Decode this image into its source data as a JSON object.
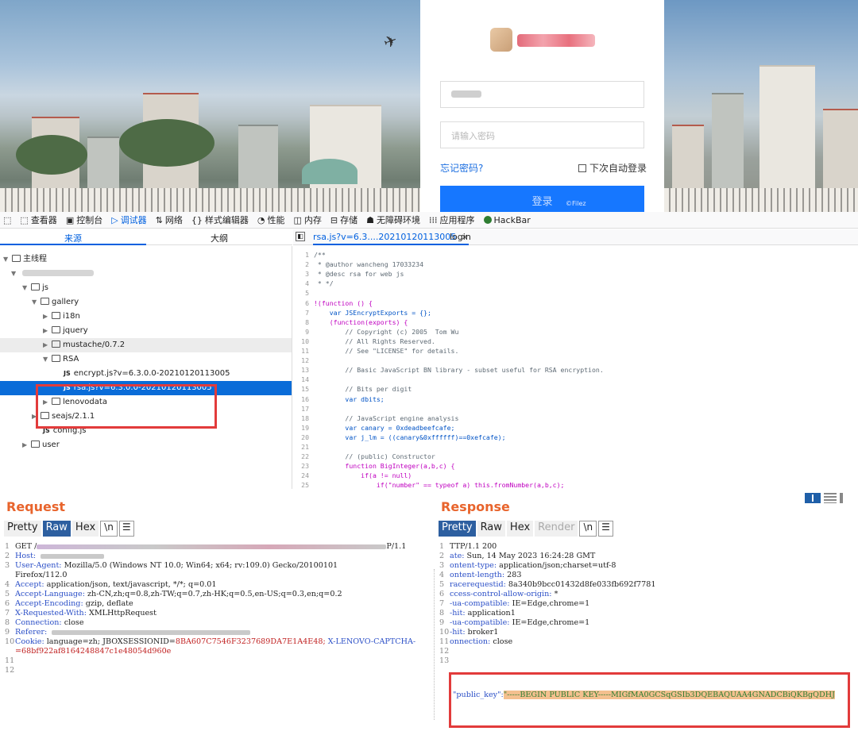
{
  "login": {
    "password_placeholder": "请输入密码",
    "forgot_password": "忘记密码?",
    "auto_login": "下次自动登录",
    "login_button": "登录",
    "watermark": "©Filez"
  },
  "devtools": {
    "toolbar": [
      {
        "icon": "⬚",
        "label": "查看器"
      },
      {
        "icon": "▣",
        "label": "控制台"
      },
      {
        "icon": "▷",
        "label": "调试器",
        "active": true
      },
      {
        "icon": "⇅",
        "label": "网络"
      },
      {
        "icon": "{}",
        "label": "样式编辑器"
      },
      {
        "icon": "◔",
        "label": "性能"
      },
      {
        "icon": "◫",
        "label": "内存"
      },
      {
        "icon": "⊟",
        "label": "存储"
      },
      {
        "icon": "☗",
        "label": "无障碍环境"
      },
      {
        "icon": "⁞⁞⁞",
        "label": "应用程序"
      },
      {
        "icon": "●",
        "label": "HackBar"
      }
    ],
    "tabs": {
      "sources": "来源",
      "outline": "大纲"
    },
    "tree": {
      "main_thread": "主线程",
      "js": "js",
      "gallery": "gallery",
      "i18n": "i18n",
      "jquery": "jquery",
      "mustache": "mustache/0.7.2",
      "rsa": "RSA",
      "encrypt_file": "encrypt.js?v=6.3.0.0-20210120113005",
      "rsa_file": "rsa.js?v=6.3.0.0-20210120113005",
      "lenovodata": "lenovodata",
      "seajs": "seajs/2.1.1",
      "config": "config.js",
      "user": "user",
      "js_badge": "JS"
    },
    "code_tabs": {
      "rsa": "rsa.js?v=6.3....20210120113005",
      "close": "×",
      "login": "login"
    },
    "code_lines": [
      {
        "n": "1",
        "t": "/**",
        "c": "c-cm"
      },
      {
        "n": "2",
        "t": " * @author wancheng 17033234",
        "c": "c-cm"
      },
      {
        "n": "3",
        "t": " * @desc rsa for web js",
        "c": "c-cm"
      },
      {
        "n": "4",
        "t": " * */",
        "c": "c-cm"
      },
      {
        "n": "5",
        "t": "",
        "c": "c-def"
      },
      {
        "n": "6",
        "t": "!(function () {",
        "c": "c-kw"
      },
      {
        "n": "7",
        "t": "    var JSEncryptExports = {};",
        "c": "c-fn"
      },
      {
        "n": "8",
        "t": "    (function(exports) {",
        "c": "c-kw"
      },
      {
        "n": "9",
        "t": "        // Copyright (c) 2005  Tom Wu",
        "c": "c-cm"
      },
      {
        "n": "10",
        "t": "        // All Rights Reserved.",
        "c": "c-cm"
      },
      {
        "n": "11",
        "t": "        // See \"LICENSE\" for details.",
        "c": "c-cm"
      },
      {
        "n": "12",
        "t": "",
        "c": "c-def"
      },
      {
        "n": "13",
        "t": "        // Basic JavaScript BN library - subset useful for RSA encryption.",
        "c": "c-cm"
      },
      {
        "n": "14",
        "t": "",
        "c": "c-def"
      },
      {
        "n": "15",
        "t": "        // Bits per digit",
        "c": "c-cm"
      },
      {
        "n": "16",
        "t": "        var dbits;",
        "c": "c-fn"
      },
      {
        "n": "17",
        "t": "",
        "c": "c-def"
      },
      {
        "n": "18",
        "t": "        // JavaScript engine analysis",
        "c": "c-cm"
      },
      {
        "n": "19",
        "t": "        var canary = 0xdeadbeefcafe;",
        "c": "c-fn"
      },
      {
        "n": "20",
        "t": "        var j_lm = ((canary&0xffffff)==0xefcafe);",
        "c": "c-fn"
      },
      {
        "n": "21",
        "t": "",
        "c": "c-def"
      },
      {
        "n": "22",
        "t": "        // (public) Constructor",
        "c": "c-cm"
      },
      {
        "n": "23",
        "t": "        function BigInteger(a,b,c) {",
        "c": "c-kw"
      },
      {
        "n": "24",
        "t": "            if(a != null)",
        "c": "c-kw"
      },
      {
        "n": "25",
        "t": "                if(\"number\" == typeof a) this.fromNumber(a,b,c);",
        "c": "c-kw"
      }
    ]
  },
  "burp": {
    "request_title": "Request",
    "response_title": "Response",
    "request_buttons": [
      "Pretty",
      "Raw",
      "Hex",
      "\\n",
      "☰"
    ],
    "response_buttons": [
      "Pretty",
      "Raw",
      "Hex",
      "Render",
      "\\n",
      "☰"
    ],
    "request_lines": [
      {
        "n": "1",
        "k": "GET /",
        "v": "",
        "tail": "P/1.1"
      },
      {
        "n": "2",
        "k": "Host:",
        "v": ""
      },
      {
        "n": "3",
        "k": "User-Agent:",
        "v": " Mozilla/5.0 (Windows NT 10.0; Win64; x64; rv:109.0) Gecko/20100101"
      },
      {
        "n": "",
        "k": "",
        "v": "Firefox/112.0"
      },
      {
        "n": "4",
        "k": "Accept:",
        "v": " application/json, text/javascript, */*; q=0.01"
      },
      {
        "n": "5",
        "k": "Accept-Language:",
        "v": " zh-CN,zh;q=0.8,zh-TW;q=0.7,zh-HK;q=0.5,en-US;q=0.3,en;q=0.2"
      },
      {
        "n": "6",
        "k": "Accept-Encoding:",
        "v": " gzip, deflate"
      },
      {
        "n": "7",
        "k": "X-Requested-With:",
        "v": " XMLHttpRequest"
      },
      {
        "n": "8",
        "k": "Connection:",
        "v": " close"
      },
      {
        "n": "9",
        "k": "Referer:",
        "v": ""
      },
      {
        "n": "10",
        "k": "Cookie:",
        "v": " language=zh; JBOXSESSIONID=",
        "red": "8BA607C7546F3237689DA7E1A4E48;",
        "k2": " X-LENOVO-CAPTCHA-"
      },
      {
        "n": "",
        "k": "",
        "red": "=68bf922af8164248847c1e48054d960e"
      },
      {
        "n": "11",
        "k": "",
        "v": ""
      },
      {
        "n": "12",
        "k": "",
        "v": ""
      }
    ],
    "response_lines": [
      {
        "n": "1",
        "k": "",
        "v": "TTP/1.1 200"
      },
      {
        "n": "2",
        "k": "ate:",
        "v": " Sun, 14 May 2023 16:24:28 GMT"
      },
      {
        "n": "3",
        "k": "ontent-type:",
        "v": " application/json;charset=utf-8"
      },
      {
        "n": "4",
        "k": "ontent-length:",
        "v": " 283"
      },
      {
        "n": "5",
        "k": "racerequestid:",
        "v": " 8a340b9bcc01432d8fe033fb692f7781"
      },
      {
        "n": "6",
        "k": "ccess-control-allow-origin:",
        "v": " *"
      },
      {
        "n": "7",
        "k": "-ua-compatible:",
        "v": " IE=Edge,chrome=1"
      },
      {
        "n": "8",
        "k": "-hit:",
        "v": " application1"
      },
      {
        "n": "9",
        "k": "-ua-compatible:",
        "v": " IE=Edge,chrome=1"
      },
      {
        "n": "10",
        "k": "-hit:",
        "v": " broker1"
      },
      {
        "n": "11",
        "k": "onnection:",
        "v": " close"
      },
      {
        "n": "12",
        "k": "",
        "v": ""
      },
      {
        "n": "13",
        "k": "",
        "v": ""
      }
    ],
    "public_key_label": "\"public_key\":",
    "public_key_value": "\"-----BEGIN PUBLIC KEY-----MIGfMA0GCSqGSIb3DQEBAQUAA4GNADCBiQKBgQDHJ"
  },
  "colors": {
    "accent": "#1677ff",
    "burp_title": "#e8642c",
    "highlight_box": "#e23b3b",
    "selected_row": "#0a6cd8"
  }
}
